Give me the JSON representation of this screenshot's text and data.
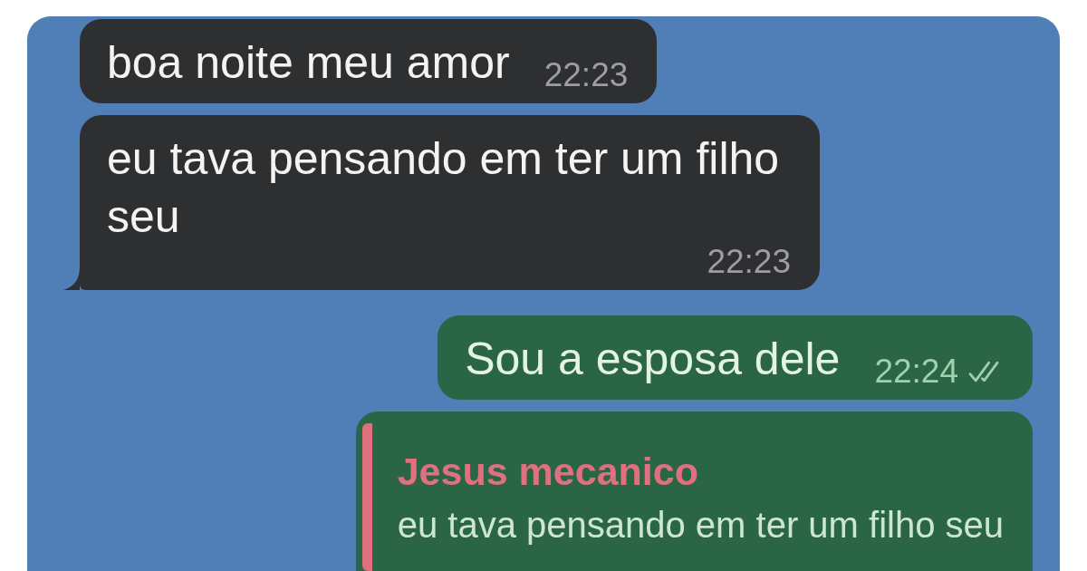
{
  "chat": {
    "messages": [
      {
        "kind": "incoming",
        "text": "boa noite meu amor",
        "time": "22:23",
        "tail": false
      },
      {
        "kind": "incoming",
        "text": "eu tava pensando em ter um filho seu",
        "time": "22:23",
        "tail": true
      },
      {
        "kind": "outgoing",
        "text": "Sou a esposa dele",
        "time": "22:24",
        "read": true,
        "tail": false
      },
      {
        "kind": "outgoing",
        "tail": false,
        "reply_to": {
          "author": "Jesus mecanico",
          "text": "eu tava pensando em ter um filho seu"
        }
      }
    ]
  }
}
